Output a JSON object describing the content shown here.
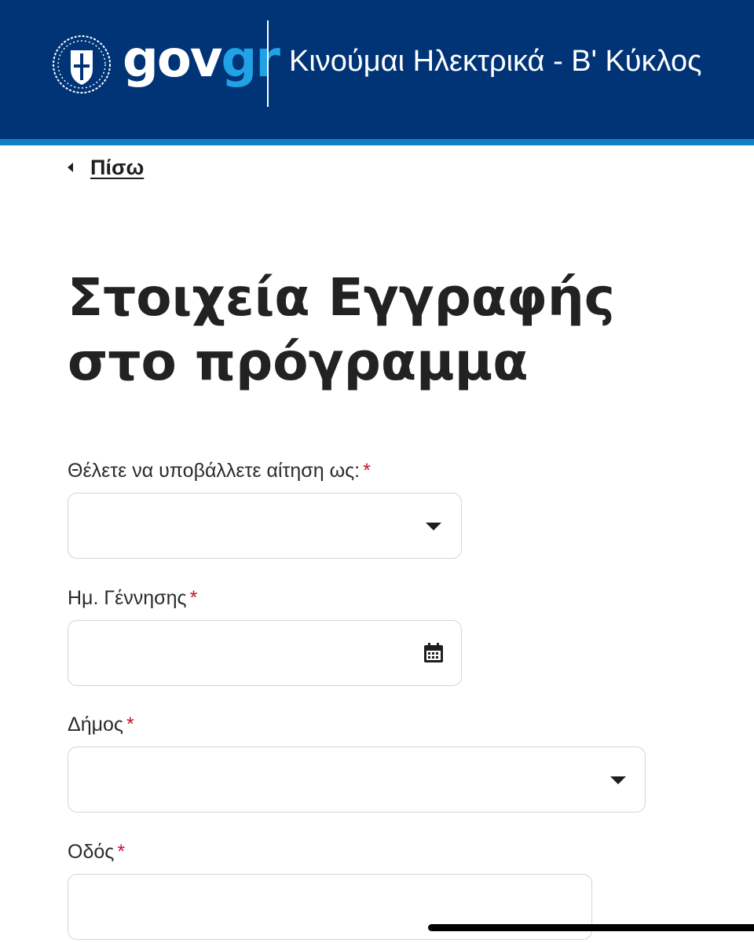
{
  "header": {
    "logo": {
      "gov": "gov",
      "gr": "gr"
    },
    "service_title": "Κινούμαι Ηλεκτρικά - Β' Κύκλος",
    "colors": {
      "background": "#003476",
      "stripe": "#0e81c3",
      "logo_accent": "#21a1e6"
    }
  },
  "nav": {
    "back_label": "Πίσω",
    "back_icon": "caret-left-icon"
  },
  "page": {
    "title": "Στοιχεία Εγγραφής στο πρόγραμμα"
  },
  "form": {
    "required_mark": "*",
    "required_color": "#c8102e",
    "fields": {
      "applicant_type": {
        "label": "Θέλετε να υποβάλλετε αίτηση ως:",
        "value": "",
        "control": "select",
        "icon": "chevron-down-icon"
      },
      "birth_date": {
        "label": "Ημ. Γέννησης",
        "value": "",
        "control": "date",
        "icon": "calendar-icon"
      },
      "municipality": {
        "label": "Δήμος",
        "value": "",
        "control": "select",
        "icon": "chevron-down-icon"
      },
      "street": {
        "label": "Οδός",
        "value": "",
        "control": "text"
      }
    }
  }
}
